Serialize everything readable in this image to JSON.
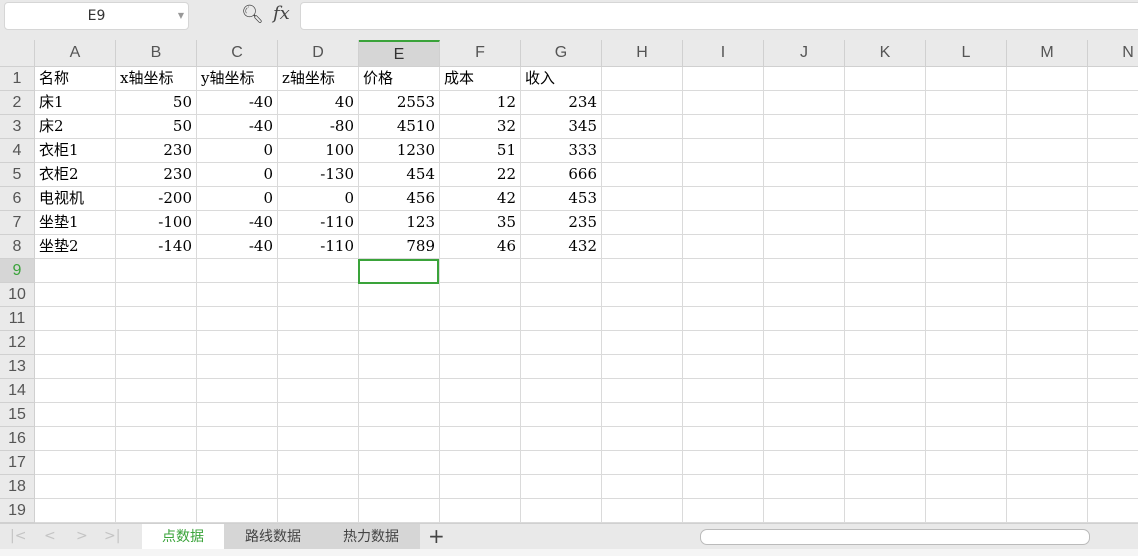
{
  "name_box": "E9",
  "formula_value": "",
  "columns": [
    "A",
    "B",
    "C",
    "D",
    "E",
    "F",
    "G",
    "H",
    "I",
    "J",
    "K",
    "L",
    "M",
    "N"
  ],
  "selected_col": "E",
  "selected_row": 9,
  "rows": [
    [
      "名称",
      "x轴坐标",
      "y轴坐标",
      "z轴坐标",
      "价格",
      "成本",
      "收入"
    ],
    [
      "床1",
      "50",
      "-40",
      "40",
      "2553",
      "12",
      "234"
    ],
    [
      "床2",
      "50",
      "-40",
      "-80",
      "4510",
      "32",
      "345"
    ],
    [
      "衣柜1",
      "230",
      "0",
      "100",
      "1230",
      "51",
      "333"
    ],
    [
      "衣柜2",
      "230",
      "0",
      "-130",
      "454",
      "22",
      "666"
    ],
    [
      "电视机",
      "-200",
      "0",
      "0",
      "456",
      "42",
      "453"
    ],
    [
      "坐垫1",
      "-100",
      "-40",
      "-110",
      "123",
      "35",
      "235"
    ],
    [
      "坐垫2",
      "-140",
      "-40",
      "-110",
      "789",
      "46",
      "432"
    ]
  ],
  "row_count": 19,
  "sheets": [
    {
      "label": "点数据",
      "active": true
    },
    {
      "label": "路线数据",
      "active": false
    },
    {
      "label": "热力数据",
      "active": false
    }
  ],
  "add_sheet": "+",
  "accent": "#3aa33a"
}
